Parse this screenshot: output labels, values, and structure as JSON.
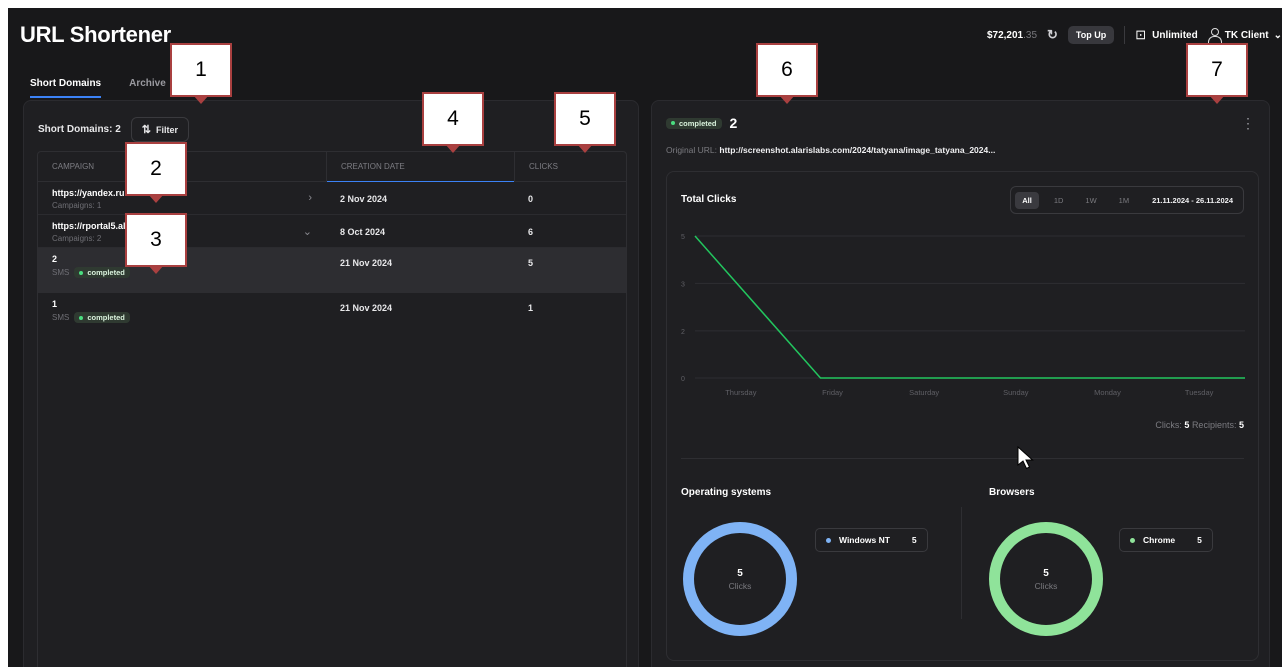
{
  "app": {
    "title": "URL Shortener"
  },
  "topbar": {
    "balance_main": "$72,201",
    "balance_cents": ".35",
    "refresh_icon": "refresh-icon",
    "topup_label": "Top Up",
    "plan_label": "Unlimited",
    "user_label": "TK Client"
  },
  "tabs": [
    {
      "label": "Short Domains",
      "active": true
    },
    {
      "label": "Archive",
      "active": false
    }
  ],
  "left_panel": {
    "count_label": "Short Domains: 2",
    "filter_label": "Filter",
    "columns": {
      "campaign": "CAMPAIGN",
      "date": "CREATION DATE",
      "clicks": "CLICKS"
    },
    "rows": [
      {
        "title": "https://yandex.ru",
        "sub": "Campaigns: 1",
        "date": "2 Nov 2024",
        "clicks": "0",
        "chevron": "›"
      },
      {
        "title": "https://rportal5.alarislabs.com",
        "sub": "Campaigns: 2",
        "date": "8 Oct 2024",
        "clicks": "6",
        "chevron": "⌄"
      },
      {
        "title": "2",
        "channel": "SMS",
        "status": "completed",
        "date": "21 Nov 2024",
        "clicks": "5"
      },
      {
        "title": "1",
        "channel": "SMS",
        "status": "completed",
        "date": "21 Nov 2024",
        "clicks": "1"
      }
    ]
  },
  "detail": {
    "status": "completed",
    "name": "2",
    "orig_label": "Original URL:",
    "orig_value": "http://screenshot.alarislabs.com/2024/tatyana/image_tatyana_2024...",
    "total_clicks_label": "Total Clicks",
    "ranges": [
      "All",
      "1D",
      "1W",
      "1M"
    ],
    "date_range": "21.11.2024 - 26.11.2024",
    "totals": {
      "clicks_label": "Clicks:",
      "clicks_value": "5",
      "recipients_label": "Recipients:",
      "recipients_value": "5"
    },
    "os_title": "Operating systems",
    "browsers_title": "Browsers",
    "os_legend": {
      "name": "Windows NT",
      "value": "5",
      "color": "#7fb3f5"
    },
    "browser_legend": {
      "name": "Chrome",
      "value": "5",
      "color": "#8fe39a"
    },
    "donut_value": "5",
    "donut_label": "Clicks"
  },
  "chart_data": {
    "type": "line",
    "x": [
      "Thursday",
      "Friday",
      "Saturday",
      "Sunday",
      "Monday",
      "Tuesday"
    ],
    "y_ticks": [
      "0",
      "2",
      "3",
      "5"
    ],
    "series": [
      {
        "values": [
          5,
          0,
          0,
          0,
          0,
          0
        ],
        "color": "#22c55e"
      }
    ],
    "ylim": [
      0,
      5
    ]
  },
  "callouts": [
    "1",
    "2",
    "3",
    "4",
    "5",
    "6",
    "7"
  ]
}
